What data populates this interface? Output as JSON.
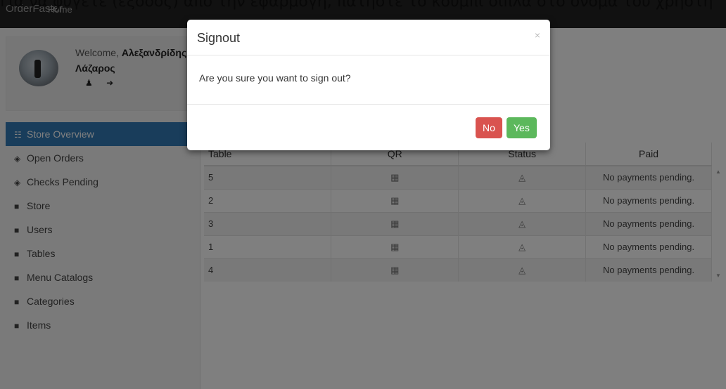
{
  "caption": "Για να φύγετε (έξοδος) από την εφαρμογή, πατήστε το κουμπί δίπλα στο όνομα του χρήστη",
  "navbar": {
    "brand": "OrderFaster",
    "home": "Home"
  },
  "profile": {
    "welcome": "Welcome,",
    "first_name": "Αλεξανδρίδης",
    "last_name": "Λάζαρος",
    "icons": [
      "user-icon",
      "sign-out-icon"
    ]
  },
  "sidebar": {
    "items": [
      {
        "label": "Store Overview",
        "icon": "sitemap-icon",
        "active": true
      },
      {
        "label": "Open Orders",
        "icon": "diamond-icon"
      },
      {
        "label": "Checks Pending",
        "icon": "diamond-icon"
      },
      {
        "label": "Store",
        "icon": "book-icon"
      },
      {
        "label": "Users",
        "icon": "book-icon"
      },
      {
        "label": "Tables",
        "icon": "book-icon"
      },
      {
        "label": "Menu Catalogs",
        "icon": "book-icon"
      },
      {
        "label": "Categories",
        "icon": "book-icon"
      },
      {
        "label": "Items",
        "icon": "book-icon"
      }
    ]
  },
  "table": {
    "headers": [
      "Table",
      "QR",
      "Status",
      "Paid"
    ],
    "rows": [
      {
        "table": "5",
        "paid": "No payments pending."
      },
      {
        "table": "2",
        "paid": "No payments pending."
      },
      {
        "table": "3",
        "paid": "No payments pending."
      },
      {
        "table": "1",
        "paid": "No payments pending."
      },
      {
        "table": "4",
        "paid": "No payments pending."
      }
    ]
  },
  "modal": {
    "title": "Signout",
    "close": "×",
    "message": "Are you sure you want to sign out?",
    "no_label": "No",
    "yes_label": "Yes"
  },
  "colors": {
    "active_item": "#337ab7",
    "btn_no": "#d9534f",
    "btn_yes": "#5cb85c",
    "navbar": "#222222"
  }
}
